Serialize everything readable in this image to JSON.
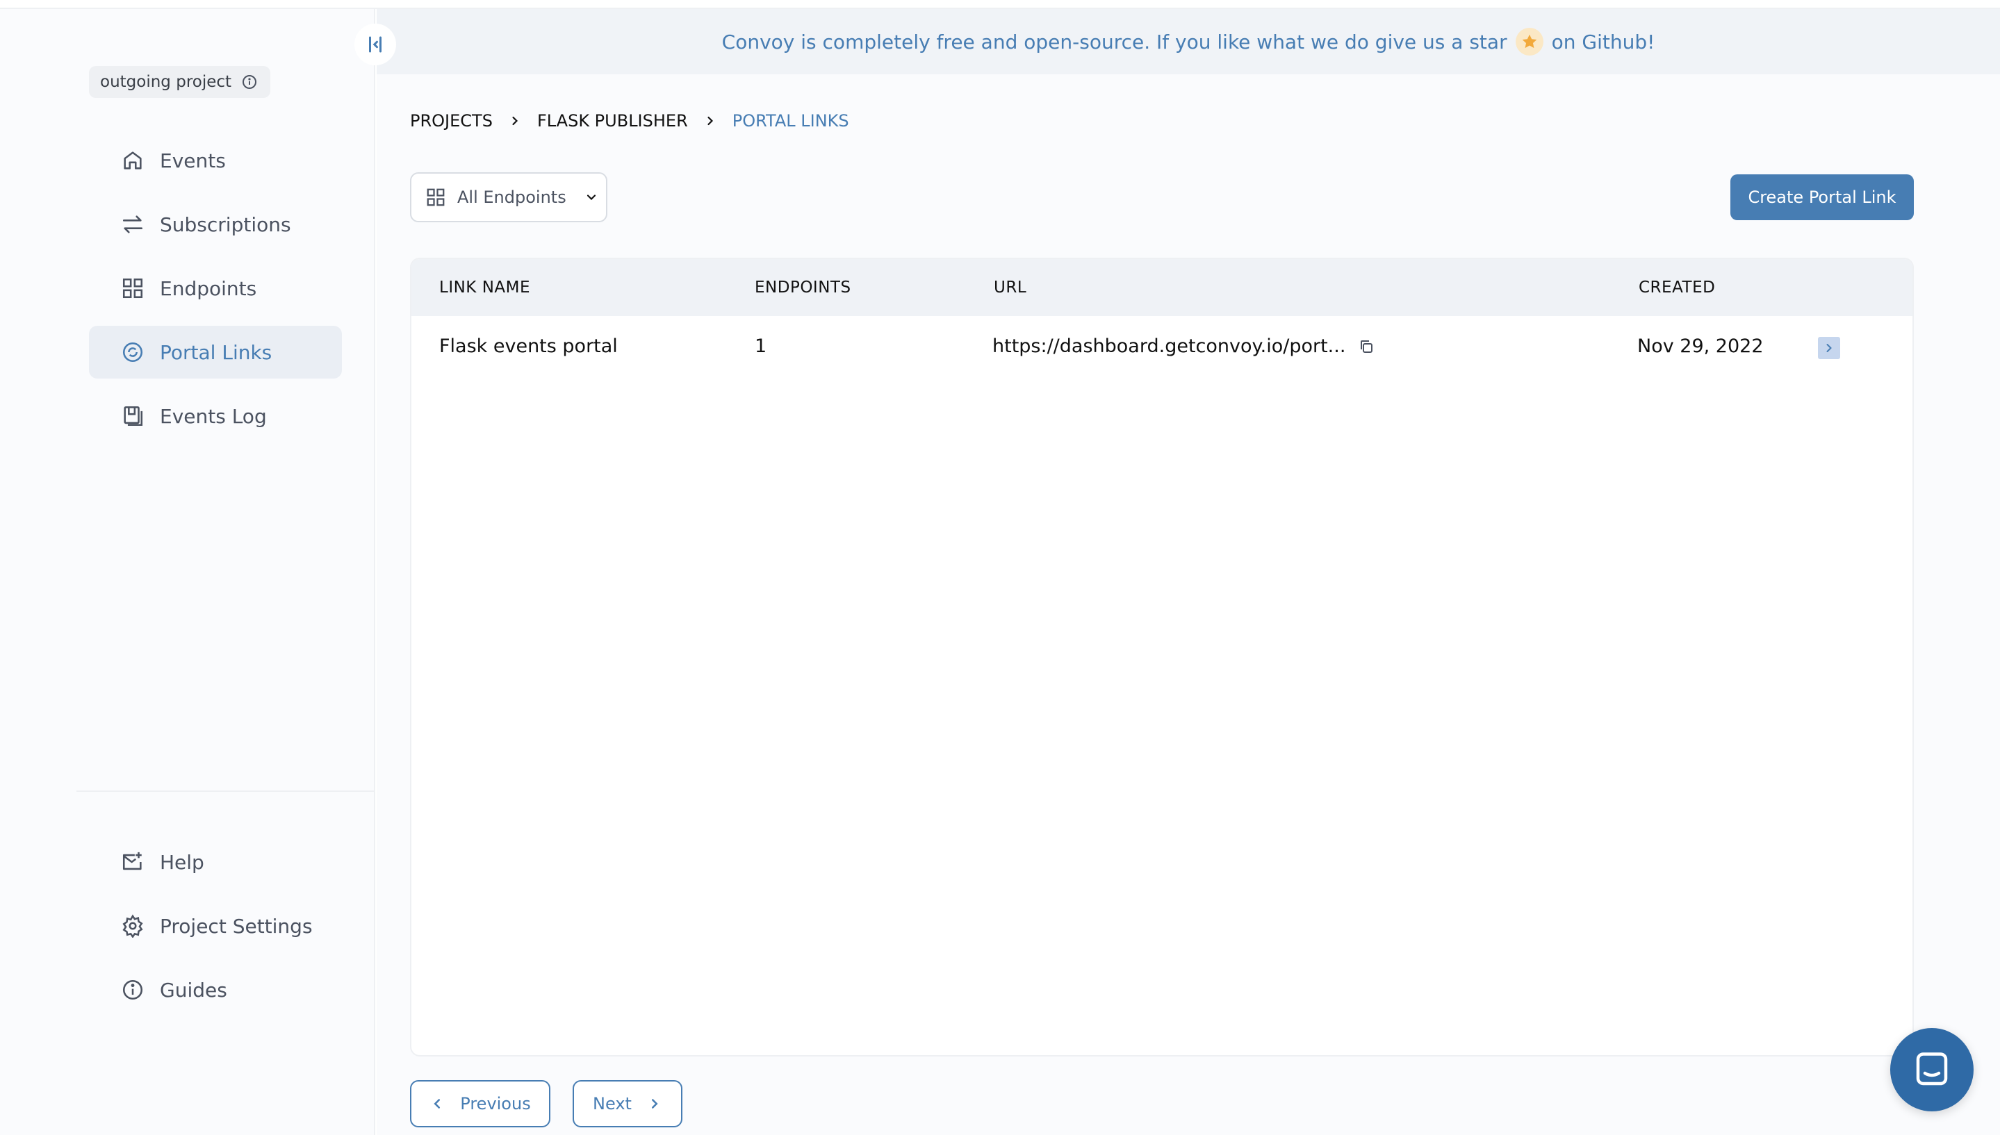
{
  "banner": {
    "text_before": "Convoy is completely free and open-source. If you like what we do give us a star",
    "text_after": "on Github!",
    "icon": "star-icon",
    "accent": "#477db3"
  },
  "sidebar": {
    "project_label": "outgoing project",
    "nav_top": [
      {
        "label": "Events",
        "icon": "home-icon"
      },
      {
        "label": "Subscriptions",
        "icon": "arrows-icon"
      },
      {
        "label": "Endpoints",
        "icon": "grid-icon"
      },
      {
        "label": "Portal Links",
        "icon": "portal-icon",
        "active": true
      },
      {
        "label": "Events Log",
        "icon": "log-icon"
      }
    ],
    "nav_bottom": [
      {
        "label": "Help",
        "icon": "mail-icon"
      },
      {
        "label": "Project Settings",
        "icon": "gear-icon"
      },
      {
        "label": "Guides",
        "icon": "info-icon"
      }
    ]
  },
  "breadcrumb": [
    "PROJECTS",
    "FLASK PUBLISHER",
    "PORTAL LINKS"
  ],
  "filter": {
    "label": "All Endpoints"
  },
  "create_button": "Create Portal Link",
  "table": {
    "headers": [
      "LINK NAME",
      "ENDPOINTS",
      "URL",
      "CREATED"
    ],
    "rows": [
      {
        "name": "Flask events portal",
        "endpoints": "1",
        "url": "https://dashboard.getconvoy.io/port...",
        "created": "Nov 29, 2022"
      }
    ]
  },
  "pagination": {
    "previous": "Previous",
    "next": "Next"
  }
}
